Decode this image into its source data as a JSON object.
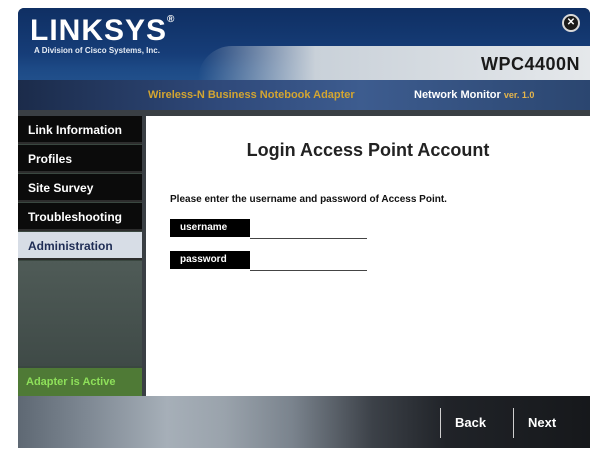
{
  "brand": {
    "name": "LINKSYS",
    "mark": "®",
    "subtitle": "A Division of Cisco Systems, Inc."
  },
  "model": "WPC4400N",
  "subheader": {
    "product": "Wireless-N Business Notebook Adapter",
    "app": "Network Monitor",
    "version": "ver. 1.0"
  },
  "sidebar": {
    "items": [
      {
        "label": "Link Information"
      },
      {
        "label": "Profiles"
      },
      {
        "label": "Site Survey"
      },
      {
        "label": "Troubleshooting"
      },
      {
        "label": "Administration"
      }
    ],
    "status": "Adapter is Active"
  },
  "main": {
    "title": "Login Access Point Account",
    "instructions": "Please enter the username and password of Access Point.",
    "username_label": "username",
    "username_value": "",
    "password_label": "password",
    "password_value": ""
  },
  "footer": {
    "back_label": "Back",
    "next_label": "Next"
  },
  "colors": {
    "accent_gold": "#d3a531",
    "active_green": "#8ee05a",
    "nav_active_bg": "#d7dde6"
  }
}
